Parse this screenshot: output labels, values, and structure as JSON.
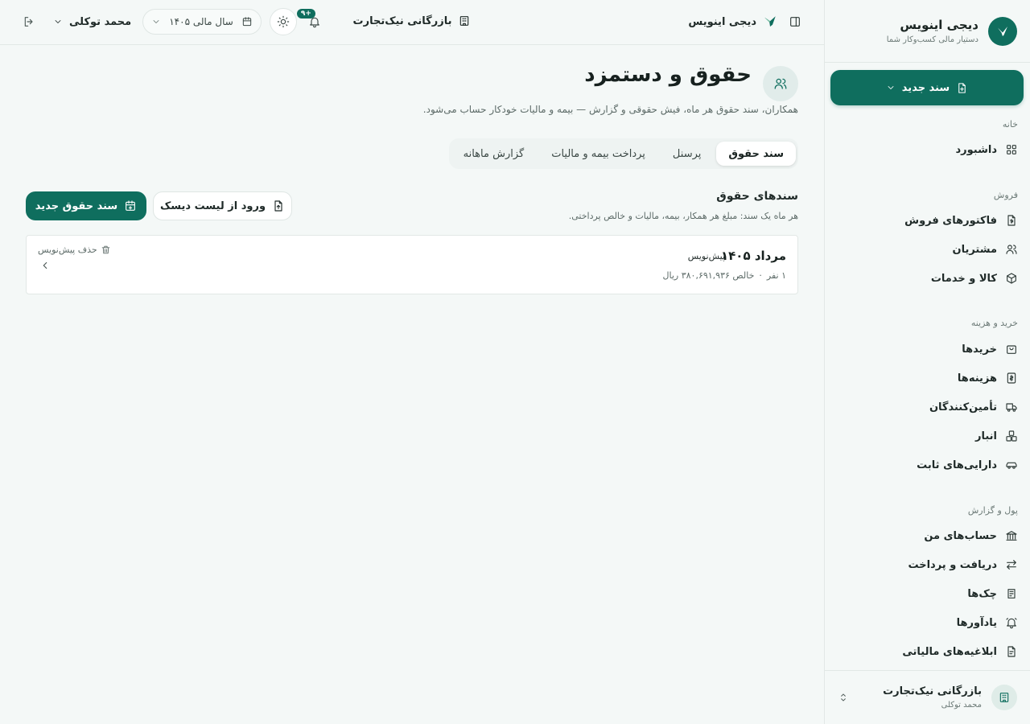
{
  "app": {
    "name": "دیجی اینویس",
    "tagline": "دستیار مالی کسب‌وکار شما"
  },
  "colors": {
    "primary": "#0f6e5e",
    "background": "#f4f8f7"
  },
  "sidebar": {
    "new_doc_label": "سند جدید",
    "groups": [
      {
        "title": "خانه",
        "items": [
          {
            "label": "داشبورد",
            "icon": "grid-icon"
          }
        ]
      },
      {
        "title": "فروش",
        "items": [
          {
            "label": "فاکتورهای فروش",
            "icon": "file-dollar-icon"
          },
          {
            "label": "مشتریان",
            "icon": "users-icon"
          },
          {
            "label": "کالا و خدمات",
            "icon": "box-icon"
          }
        ]
      },
      {
        "title": "خرید و هزینه",
        "items": [
          {
            "label": "خریدها",
            "icon": "bag-icon"
          },
          {
            "label": "هزینه‌ها",
            "icon": "receipt-icon"
          },
          {
            "label": "تأمین‌کنندگان",
            "icon": "truck-icon"
          },
          {
            "label": "انبار",
            "icon": "boxes-icon"
          },
          {
            "label": "دارایی‌های ثابت",
            "icon": "car-icon"
          }
        ]
      },
      {
        "title": "پول و گزارش",
        "items": [
          {
            "label": "حساب‌های من",
            "icon": "bank-icon"
          },
          {
            "label": "دریافت و پرداخت",
            "icon": "arrows-icon"
          },
          {
            "label": "چک‌ها",
            "icon": "cheque-icon"
          },
          {
            "label": "یادآورها",
            "icon": "bell-ring-icon"
          },
          {
            "label": "ابلاغیه‌های مالیاتی",
            "icon": "notice-icon"
          }
        ]
      }
    ],
    "footer": {
      "org": "بازرگانی نیک‌تجارت",
      "user": "محمد توکلی"
    }
  },
  "topbar": {
    "app_name": "دیجی اینویس",
    "org_name": "بازرگانی نیک‌تجارت",
    "notifications_count": "۹+",
    "fiscal_year": "سال مالی ۱۴۰۵",
    "user_name": "محمد توکلی"
  },
  "page": {
    "title": "حقوق و دستمزد",
    "subtitle": "همکاران، سند حقوق هر ماه، فیش حقوقی و گزارش — بیمه و مالیات خودکار حساب می‌شود.",
    "tabs": [
      {
        "label": "سند حقوق",
        "active": true
      },
      {
        "label": "پرسنل",
        "active": false
      },
      {
        "label": "پرداخت بیمه و مالیات",
        "active": false
      },
      {
        "label": "گزارش ماهانه",
        "active": false
      }
    ],
    "section_title": "سندهای حقوق",
    "section_subtitle": "هر ماه یک سند: مبلغ هر همکار، بیمه، مالیات و خالص پرداختی.",
    "import_label": "ورود از لیست دیسک",
    "new_label": "سند حقوق جدید",
    "docs": [
      {
        "title": "مرداد ۱۴۰۵",
        "status": "پیش‌نویس",
        "people": "۱ نفر",
        "net": "خالص ۳۸۰,۶۹۱,۹۳۶ ریال",
        "delete_label": "حذف پیش‌نویس"
      }
    ]
  }
}
